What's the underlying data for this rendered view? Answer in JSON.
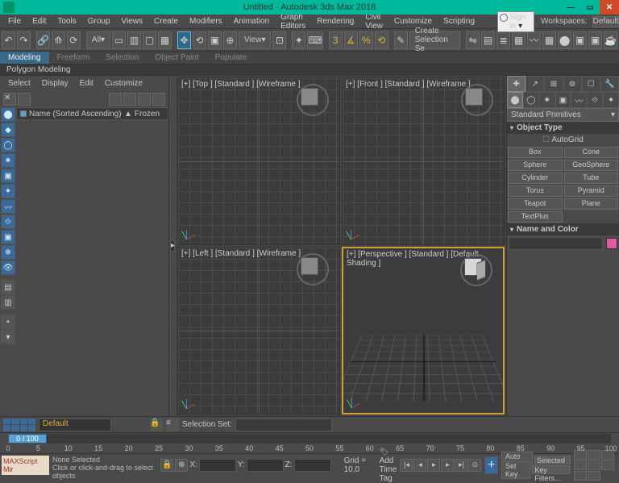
{
  "title": "Untitled - Autodesk 3ds Max 2018",
  "signin": "Sign In",
  "workspaces_lbl": "Workspaces:",
  "workspaces_val": "Default",
  "menu": [
    "File",
    "Edit",
    "Tools",
    "Group",
    "Views",
    "Create",
    "Modifiers",
    "Animation",
    "Graph Editors",
    "Rendering",
    "Civil View",
    "Customize",
    "Scripting"
  ],
  "toolbar_all": "All",
  "toolbar_view": "View",
  "toolbar_createsel": "Create Selection Se",
  "ribbon": [
    "Modeling",
    "Freeform",
    "Selection",
    "Object Paint",
    "Populate"
  ],
  "subribbon": "Polygon Modeling",
  "scene_menu": [
    "Select",
    "Display",
    "Edit",
    "Customize"
  ],
  "scene_cols": {
    "name": "Name (Sorted Ascending)",
    "frozen": "Frozen",
    "arrow": "▲"
  },
  "viewports": [
    {
      "label": "[+] [Top ] [Standard ] [Wireframe ]"
    },
    {
      "label": "[+] [Front ] [Standard ] [Wireframe ]"
    },
    {
      "label": "[+] [Left ] [Standard ] [Wireframe ]"
    },
    {
      "label": "[+] [Perspective ] [Standard ] [Default Shading ]"
    }
  ],
  "cmd": {
    "header": "Standard Primitives",
    "objtype": "Object Type",
    "autogrid": "AutoGrid",
    "rows": [
      [
        "Box",
        "Cone"
      ],
      [
        "Sphere",
        "GeoSphere"
      ],
      [
        "Cylinder",
        "Tube"
      ],
      [
        "Torus",
        "Pyramid"
      ],
      [
        "Teapot",
        "Plane"
      ],
      [
        "TextPlus",
        ""
      ]
    ],
    "namecolor": "Name and Color"
  },
  "bottom": {
    "default": "Default",
    "selset": "Selection Set:",
    "slider": "0 / 100",
    "ticks": [
      "0",
      "5",
      "10",
      "15",
      "20",
      "25",
      "30",
      "35",
      "40",
      "45",
      "50",
      "55",
      "60",
      "65",
      "70",
      "75",
      "80",
      "85",
      "90",
      "95",
      "100"
    ],
    "maxscript": "MAXScript Mir",
    "msg1": "None Selected",
    "msg2": "Click or click-and-drag to select objects",
    "x": "X:",
    "y": "Y:",
    "z": "Z:",
    "grid": "Grid = 10,0",
    "addtag": "Add Time Tag",
    "autokey": "Auto Key",
    "setkey": "Set Key",
    "selected": "Selected",
    "keyfilters": "Key Filters..."
  }
}
